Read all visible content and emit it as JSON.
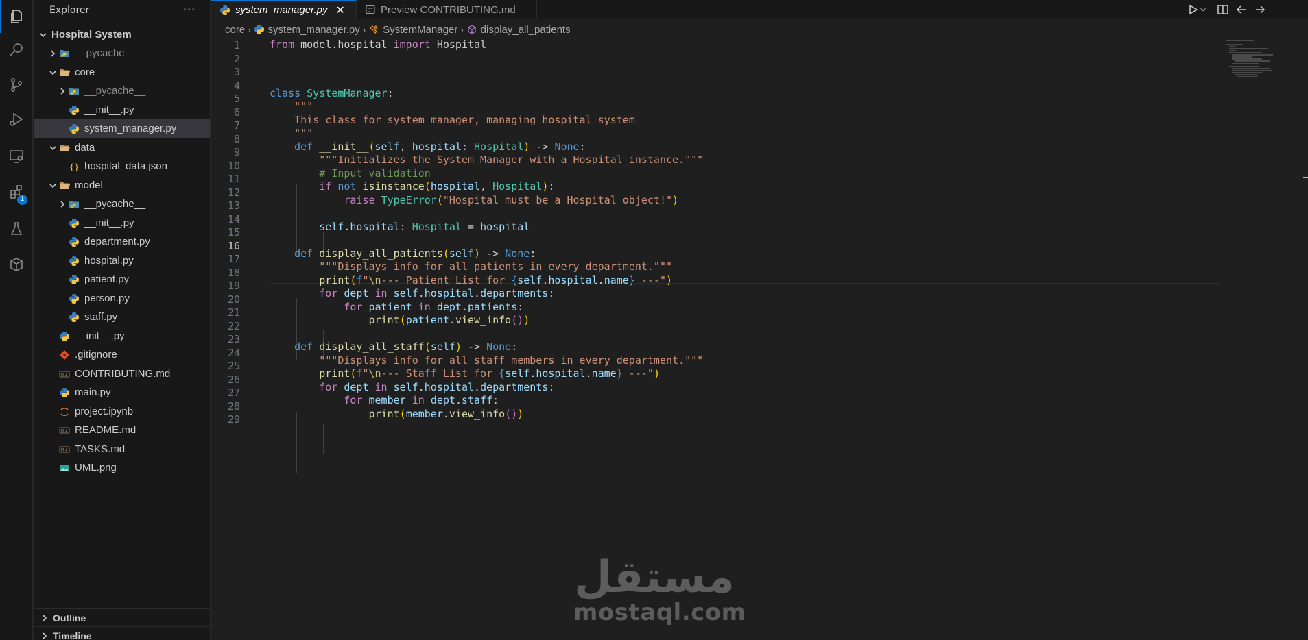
{
  "activity_bar": {
    "items": [
      "explorer-icon",
      "search-icon",
      "source-control-icon",
      "run-debug-icon",
      "remote-explorer-icon",
      "extensions-icon",
      "testing-icon",
      "containers-icon"
    ],
    "extensions_badge": "1"
  },
  "sidebar": {
    "title": "Explorer",
    "more_actions": "···",
    "root": "Hospital System",
    "items": [
      {
        "label": "__pycache__",
        "type": "folder-special",
        "dim": true
      },
      {
        "label": "core",
        "type": "folder-open"
      },
      {
        "label": "__pycache__",
        "type": "folder-special",
        "dim": true
      },
      {
        "label": "__init__.py",
        "type": "python"
      },
      {
        "label": "system_manager.py",
        "type": "python",
        "selected": true
      },
      {
        "label": "data",
        "type": "folder-open"
      },
      {
        "label": "hospital_data.json",
        "type": "json"
      },
      {
        "label": "model",
        "type": "folder-open"
      },
      {
        "label": "__pycache__",
        "type": "folder-special",
        "dim": false
      },
      {
        "label": "__init__.py",
        "type": "python"
      },
      {
        "label": "department.py",
        "type": "python"
      },
      {
        "label": "hospital.py",
        "type": "python"
      },
      {
        "label": "patient.py",
        "type": "python"
      },
      {
        "label": "person.py",
        "type": "python"
      },
      {
        "label": "staff.py",
        "type": "python"
      },
      {
        "label": "__init__.py",
        "type": "python"
      },
      {
        "label": ".gitignore",
        "type": "git"
      },
      {
        "label": "CONTRIBUTING.md",
        "type": "markdown"
      },
      {
        "label": "main.py",
        "type": "python"
      },
      {
        "label": "project.ipynb",
        "type": "notebook"
      },
      {
        "label": "README.md",
        "type": "markdown"
      },
      {
        "label": "TASKS.md",
        "type": "markdown"
      },
      {
        "label": "UML.png",
        "type": "image"
      }
    ],
    "sections": [
      "Outline",
      "Timeline"
    ]
  },
  "tabs": [
    {
      "label": "system_manager.py",
      "active": true,
      "close": "✕"
    },
    {
      "label": "Preview CONTRIBUTING.md",
      "active": false
    }
  ],
  "breadcrumb": [
    "core",
    "system_manager.py",
    "SystemManager",
    "display_all_patients"
  ],
  "editor": {
    "current_line": 16,
    "line_numbers": [
      "1",
      "2",
      "3",
      "4",
      "5",
      "6",
      "7",
      "8",
      "9",
      "10",
      "11",
      "12",
      "13",
      "14",
      "15",
      "16",
      "17",
      "18",
      "19",
      "20",
      "21",
      "22",
      "23",
      "24",
      "25",
      "26",
      "27",
      "28",
      "29"
    ]
  },
  "watermark": {
    "arabic": "مستقل",
    "latin": "mostaql.com"
  },
  "colors": {
    "accent": "#0078d4",
    "keyword": "#569cd6",
    "control": "#c586c0",
    "function": "#dcdcaa",
    "class": "#4ec9b0",
    "string": "#ce9178",
    "comment": "#6a9955"
  }
}
